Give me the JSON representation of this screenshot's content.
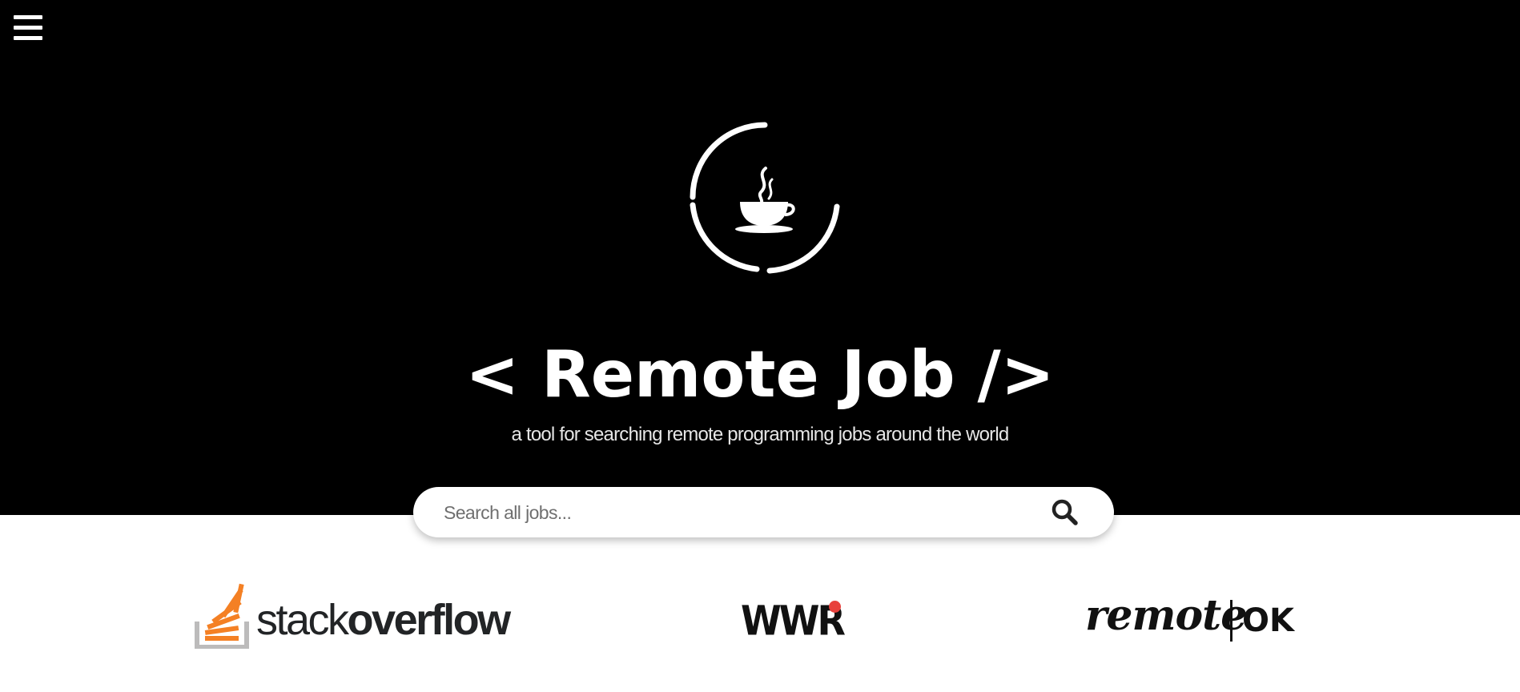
{
  "header": {
    "menu_icon": "hamburger-menu-icon",
    "logo_icon": "coffee-cup-ring-icon",
    "title": "< Remote Job />",
    "subtitle": "a tool for searching remote programming jobs around the world"
  },
  "search": {
    "placeholder": "Search all jobs...",
    "value": "",
    "icon": "search-icon"
  },
  "sources": [
    {
      "name_light": "stack",
      "name_bold": "overflow",
      "icon": "stackoverflow-logo"
    },
    {
      "name": "WWR",
      "icon": "wwr-logo"
    },
    {
      "name": "remote",
      "suffix": "OK",
      "icon": "remoteok-logo"
    }
  ],
  "colors": {
    "hero_background": "#000000",
    "stackoverflow_orange": "#f48024",
    "stackoverflow_gray": "#bcbbbb",
    "wwr_dot": "#e8413c"
  }
}
